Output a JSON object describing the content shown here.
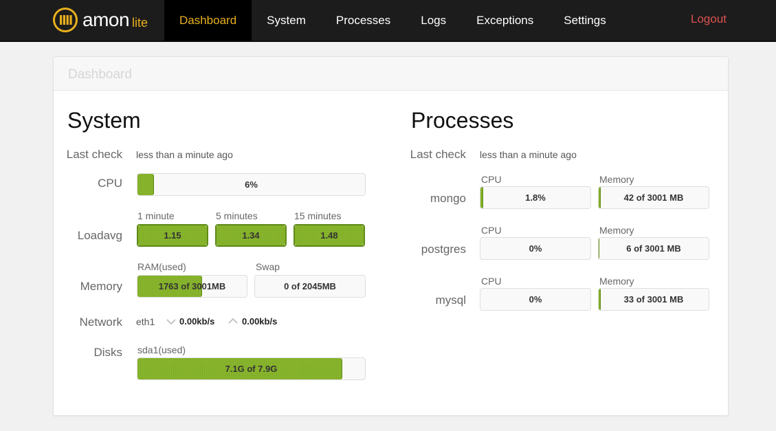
{
  "app": {
    "name": "amon",
    "edition": "lite",
    "brand_color": "#e8b01d"
  },
  "nav": {
    "items": [
      "Dashboard",
      "System",
      "Processes",
      "Logs",
      "Exceptions",
      "Settings"
    ],
    "active": "Dashboard",
    "logout": "Logout"
  },
  "page": {
    "header": "Dashboard"
  },
  "system": {
    "title": "System",
    "last_check_label": "Last check",
    "last_check_value": "less than a minute ago",
    "cpu": {
      "label": "CPU",
      "value": "6%",
      "percent": 6
    },
    "loadavg": {
      "label": "Loadavg",
      "items": [
        {
          "label": "1 minute",
          "value": "1.15"
        },
        {
          "label": "5 minutes",
          "value": "1.34"
        },
        {
          "label": "15 minutes",
          "value": "1.48"
        }
      ]
    },
    "memory": {
      "label": "Memory",
      "ram_label": "RAM(used)",
      "ram_value": "1763 of 3001MB",
      "ram_used": 1763,
      "ram_total": 3001,
      "swap_label": "Swap",
      "swap_value": "0 of 2045MB",
      "swap_used": 0,
      "swap_total": 2045
    },
    "network": {
      "label": "Network",
      "interface": "eth1",
      "down": "0.00kb/s",
      "up": "0.00kb/s"
    },
    "disks": {
      "label": "Disks",
      "name": "sda1(used)",
      "value": "7.1G of 7.9G",
      "used": 7.1,
      "total": 7.9
    }
  },
  "processes": {
    "title": "Processes",
    "last_check_label": "Last check",
    "last_check_value": "less than a minute ago",
    "cpu_label": "CPU",
    "memory_label": "Memory",
    "items": [
      {
        "name": "mongo",
        "cpu": "1.8%",
        "cpu_percent": 1.8,
        "memory": "42 of 3001 MB",
        "memory_used": 42,
        "memory_total": 3001
      },
      {
        "name": "postgres",
        "cpu": "0%",
        "cpu_percent": 0,
        "memory": "6 of 3001 MB",
        "memory_used": 6,
        "memory_total": 3001
      },
      {
        "name": "mysql",
        "cpu": "0%",
        "cpu_percent": 0,
        "memory": "33 of 3001 MB",
        "memory_used": 33,
        "memory_total": 3001
      }
    ]
  }
}
